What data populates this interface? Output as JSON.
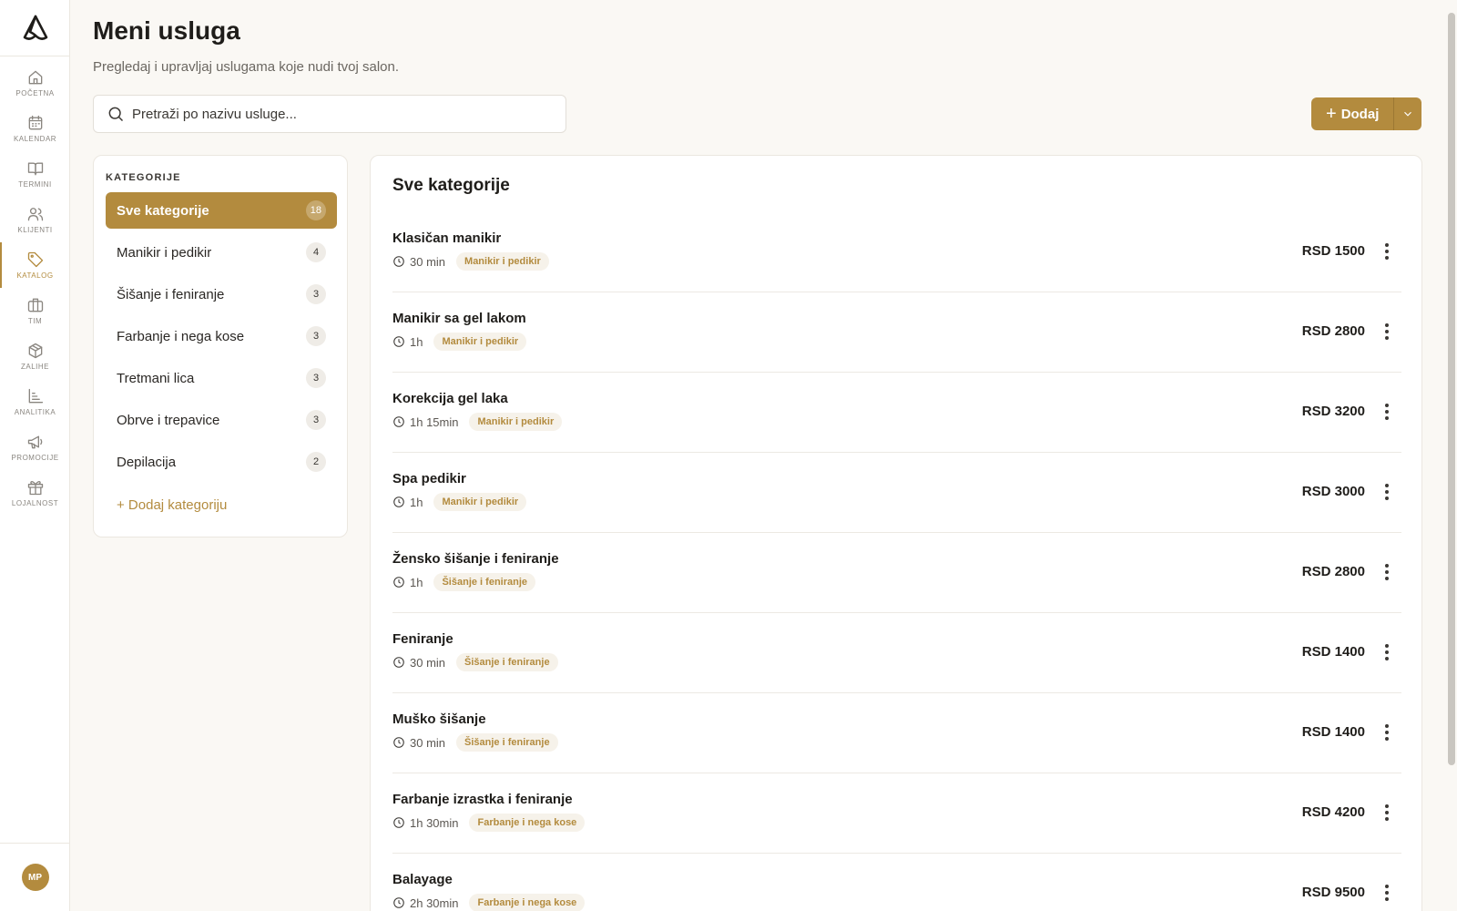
{
  "sidebar": {
    "logo_icon": "brand-logo-icon",
    "items": [
      {
        "label": "POČETNA",
        "icon": "home-icon",
        "active": false
      },
      {
        "label": "KALENDAR",
        "icon": "calendar-icon",
        "active": false
      },
      {
        "label": "TERMINI",
        "icon": "book-icon",
        "active": false
      },
      {
        "label": "KLIJENTI",
        "icon": "users-icon",
        "active": false
      },
      {
        "label": "KATALOG",
        "icon": "tag-icon",
        "active": true
      },
      {
        "label": "TIM",
        "icon": "briefcase-icon",
        "active": false
      },
      {
        "label": "ZALIHE",
        "icon": "box-icon",
        "active": false
      },
      {
        "label": "ANALITIKA",
        "icon": "chart-icon",
        "active": false
      },
      {
        "label": "PROMOCIJE",
        "icon": "megaphone-icon",
        "active": false
      },
      {
        "label": "LOJALNOST",
        "icon": "gift-icon",
        "active": false
      }
    ],
    "avatar_initials": "MP"
  },
  "header": {
    "title": "Meni usluga",
    "subtitle": "Pregledaj i upravljaj uslugama koje nudi tvoj salon."
  },
  "search": {
    "placeholder": "Pretraži po nazivu usluge..."
  },
  "actions": {
    "add_label": "Dodaj"
  },
  "categories": {
    "heading": "KATEGORIJE",
    "items": [
      {
        "label": "Sve kategorije",
        "count": "18",
        "active": true
      },
      {
        "label": "Manikir i pedikir",
        "count": "4",
        "active": false
      },
      {
        "label": "Šišanje i feniranje",
        "count": "3",
        "active": false
      },
      {
        "label": "Farbanje i nega kose",
        "count": "3",
        "active": false
      },
      {
        "label": "Tretmani lica",
        "count": "3",
        "active": false
      },
      {
        "label": "Obrve i trepavice",
        "count": "3",
        "active": false
      },
      {
        "label": "Depilacija",
        "count": "2",
        "active": false
      }
    ],
    "add_label": "+ Dodaj kategoriju"
  },
  "services": {
    "title": "Sve kategorije",
    "items": [
      {
        "name": "Klasičan manikir",
        "duration": "30 min",
        "category": "Manikir i pedikir",
        "price": "RSD 1500"
      },
      {
        "name": "Manikir sa gel lakom",
        "duration": "1h",
        "category": "Manikir i pedikir",
        "price": "RSD 2800"
      },
      {
        "name": "Korekcija gel laka",
        "duration": "1h 15min",
        "category": "Manikir i pedikir",
        "price": "RSD 3200"
      },
      {
        "name": "Spa pedikir",
        "duration": "1h",
        "category": "Manikir i pedikir",
        "price": "RSD 3000"
      },
      {
        "name": "Žensko šišanje i feniranje",
        "duration": "1h",
        "category": "Šišanje i feniranje",
        "price": "RSD 2800"
      },
      {
        "name": "Feniranje",
        "duration": "30 min",
        "category": "Šišanje i feniranje",
        "price": "RSD 1400"
      },
      {
        "name": "Muško šišanje",
        "duration": "30 min",
        "category": "Šišanje i feniranje",
        "price": "RSD 1400"
      },
      {
        "name": "Farbanje izrastka i feniranje",
        "duration": "1h 30min",
        "category": "Farbanje i nega kose",
        "price": "RSD 4200"
      },
      {
        "name": "Balayage",
        "duration": "2h 30min",
        "category": "Farbanje i nega kose",
        "price": "RSD 9500"
      }
    ]
  },
  "colors": {
    "accent": "#b38b3e",
    "background": "#faf8f4"
  }
}
